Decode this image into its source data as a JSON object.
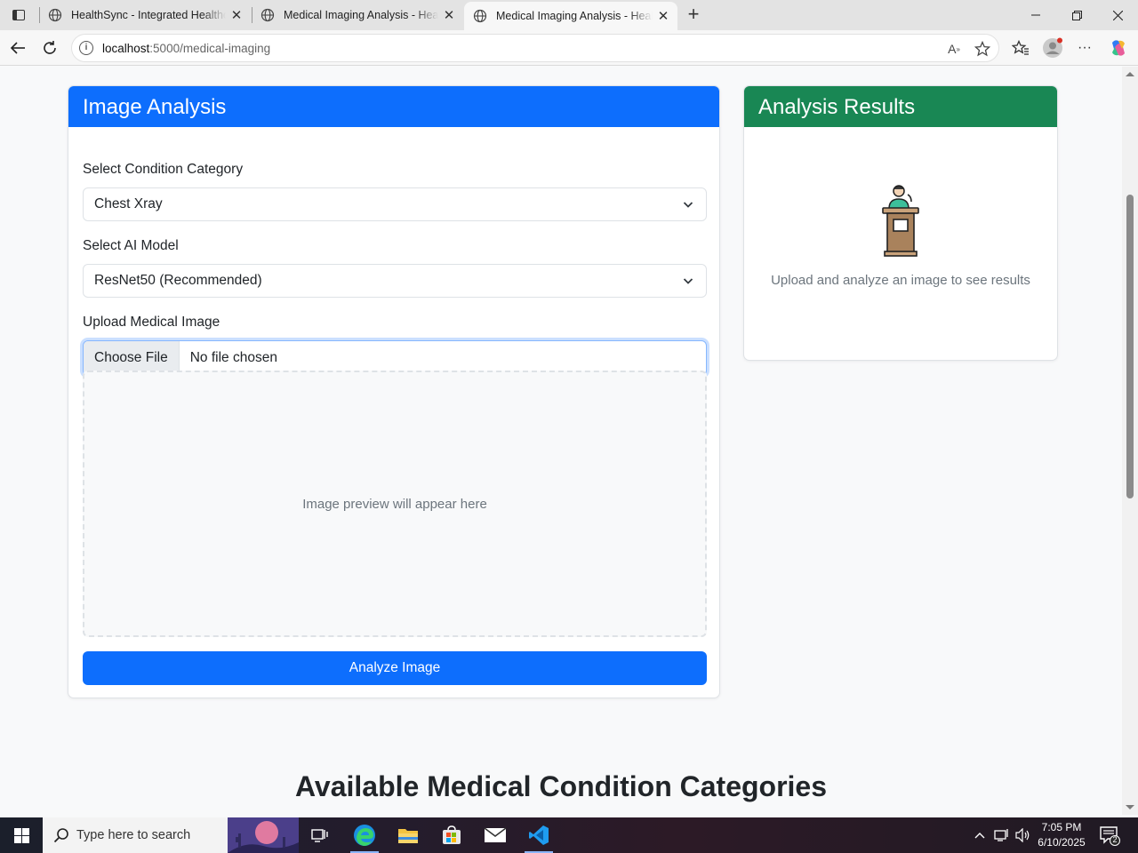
{
  "browser": {
    "tabs": [
      {
        "title": "HealthSync - Integrated Healthcare",
        "active": false
      },
      {
        "title": "Medical Imaging Analysis - HealthSync",
        "active": false
      },
      {
        "title": "Medical Imaging Analysis - HealthSync",
        "active": true
      }
    ],
    "url_host": "localhost",
    "url_path": ":5000/medical-imaging"
  },
  "analysis": {
    "title": "Image Analysis",
    "condition_label": "Select Condition Category",
    "condition_value": "Chest Xray",
    "model_label": "Select AI Model",
    "model_value": "ResNet50 (Recommended)",
    "upload_label": "Upload Medical Image",
    "choose_file": "Choose File",
    "no_file": "No file chosen",
    "preview_text": "Image preview will appear here",
    "analyze_button": "Analyze Image",
    "accent_color": "#0d6efd"
  },
  "results": {
    "title": "Analysis Results",
    "empty_text": "Upload and analyze an image to see results",
    "accent_color": "#198754",
    "icon": "podium-speaker-icon"
  },
  "categories_heading": "Available Medical Condition Categories",
  "taskbar": {
    "search_placeholder": "Type here to search",
    "time": "7:05 PM",
    "date": "6/10/2025",
    "notification_count": "2"
  }
}
